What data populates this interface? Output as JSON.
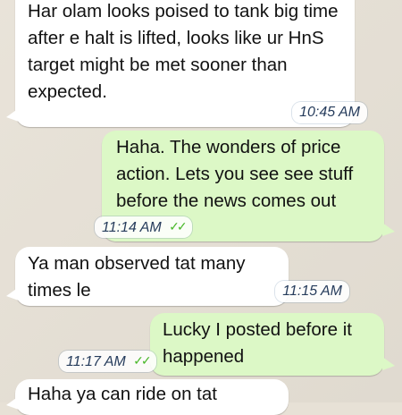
{
  "chat": {
    "messages": [
      {
        "direction": "incoming",
        "text": "Har olam looks poised to tank big time after e halt is lifted, looks like ur HnS target might be met sooner than expected.",
        "time": "10:45 AM"
      },
      {
        "direction": "outgoing",
        "text": "Haha. The wonders of price action. Lets you see see stuff before the news comes out",
        "time": "11:14 AM",
        "status_icon": "double-check-icon"
      },
      {
        "direction": "incoming",
        "text": "Ya man observed tat many times le",
        "time": "11:15 AM"
      },
      {
        "direction": "outgoing",
        "text": "Lucky I posted before it happened",
        "time": "11:17 AM",
        "status_icon": "double-check-icon"
      },
      {
        "direction": "incoming",
        "text": "Haha ya can ride on tat",
        "time": ""
      }
    ]
  }
}
